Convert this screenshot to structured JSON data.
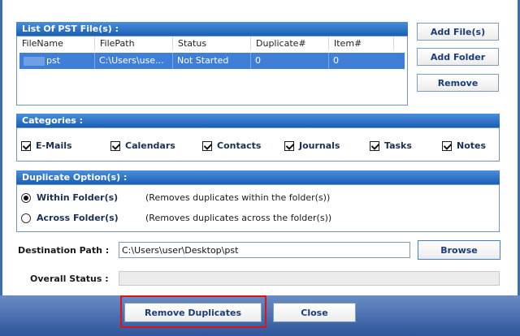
{
  "pst_files": {
    "header": "List Of PST File(s) :",
    "columns": [
      "FileName",
      "FilePath",
      "Status",
      "Duplicate#",
      "Item#"
    ],
    "rows": [
      {
        "filename": "pst",
        "filepath": "C:\\Users\\use...",
        "status": "Not Started",
        "duplicate": "0",
        "item": "0"
      }
    ]
  },
  "actions": {
    "add_files": "Add File(s)",
    "add_folder": "Add Folder",
    "remove": "Remove"
  },
  "categories": {
    "header": "Categories :",
    "items": [
      "E-Mails",
      "Calendars",
      "Contacts",
      "Journals",
      "Tasks",
      "Notes"
    ]
  },
  "duplicate_options": {
    "header": "Duplicate Option(s) :",
    "within_label": "Within Folder(s)",
    "within_desc": "(Removes duplicates within the folder(s))",
    "across_label": "Across Folder(s)",
    "across_desc": "(Removes duplicates across the folder(s))",
    "selected": "Within Folder(s)"
  },
  "destination": {
    "label": "Destination Path :",
    "value": "C:\\Users\\user\\Desktop\\pst",
    "browse": "Browse"
  },
  "overall_status": {
    "label": "Overall Status :",
    "progress": 0
  },
  "footer": {
    "remove_duplicates": "Remove Duplicates",
    "close": "Close"
  },
  "colors": {
    "header_blue": "#1a5fb5",
    "selection_blue": "#3f7fd8",
    "highlight_red": "#d9161b"
  }
}
